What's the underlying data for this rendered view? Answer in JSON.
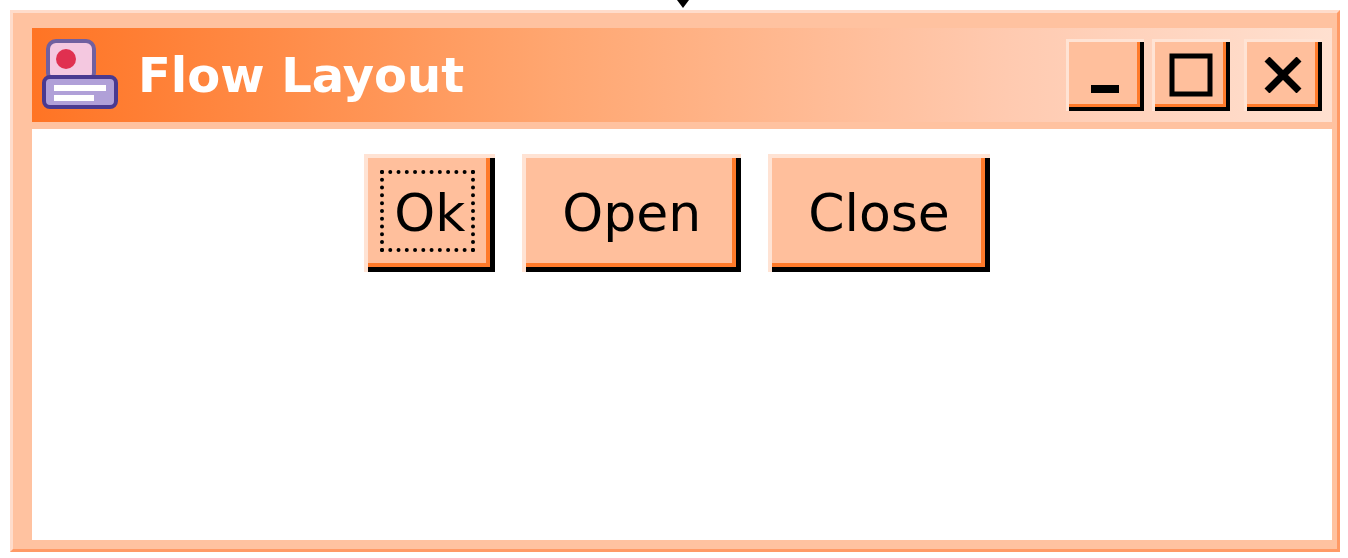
{
  "window": {
    "title": "Flow Layout"
  },
  "buttons": [
    {
      "label": "Ok",
      "focused": true
    },
    {
      "label": "Open",
      "focused": false
    },
    {
      "label": "Close",
      "focused": false
    }
  ]
}
